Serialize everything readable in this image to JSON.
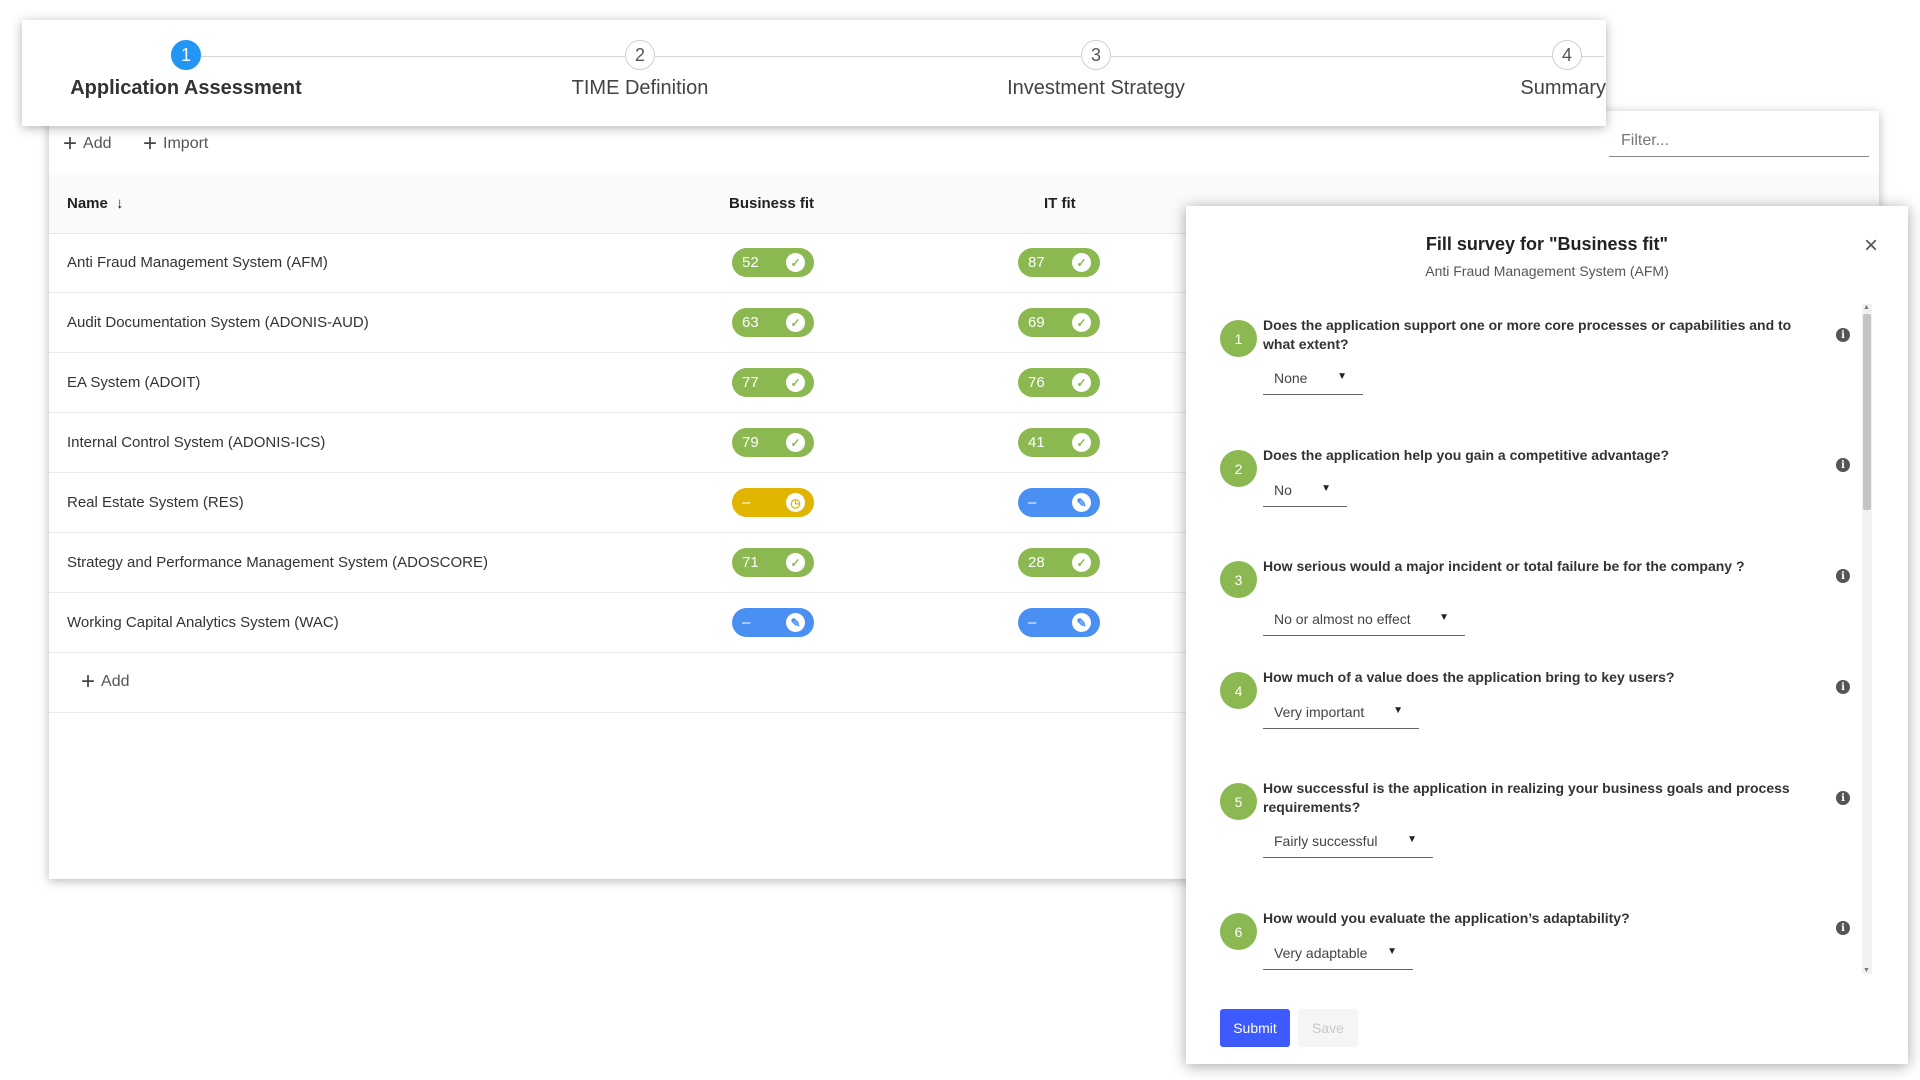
{
  "stepper": {
    "steps": [
      {
        "number": "1",
        "label": "Application Assessment"
      },
      {
        "number": "2",
        "label": "TIME Definition"
      },
      {
        "number": "3",
        "label": "Investment Strategy"
      },
      {
        "number": "4",
        "label": "Summary"
      }
    ],
    "active_step": 1
  },
  "toolbar": {
    "add_label": "Add",
    "import_label": "Import",
    "filter_placeholder": "Filter..."
  },
  "table": {
    "columns": {
      "name": "Name",
      "sort_indicator": "↓",
      "business_fit": "Business fit",
      "it_fit": "IT fit"
    },
    "rows": [
      {
        "name": "Anti Fraud Management System (AFM)",
        "business_fit": "52",
        "business_status": "done",
        "it_fit": "87",
        "it_status": "done"
      },
      {
        "name": "Audit Documentation System (ADONIS-AUD)",
        "business_fit": "63",
        "business_status": "done",
        "it_fit": "69",
        "it_status": "done"
      },
      {
        "name": "EA System (ADOIT)",
        "business_fit": "77",
        "business_status": "done",
        "it_fit": "76",
        "it_status": "done"
      },
      {
        "name": "Internal Control System (ADONIS-ICS)",
        "business_fit": "79",
        "business_status": "done",
        "it_fit": "41",
        "it_status": "done"
      },
      {
        "name": "Real Estate System (RES)",
        "business_fit": "–",
        "business_status": "pending",
        "it_fit": "–",
        "it_status": "edit"
      },
      {
        "name": "Strategy and Performance Management System (ADOSCORE)",
        "business_fit": "71",
        "business_status": "done",
        "it_fit": "28",
        "it_status": "done"
      },
      {
        "name": "Working Capital Analytics System (WAC)",
        "business_fit": "–",
        "business_status": "edit",
        "it_fit": "–",
        "it_status": "edit"
      }
    ],
    "add_row_label": "Add",
    "colors": {
      "done": "#8bb850",
      "pending": "#e0b400",
      "edit": "#4a8ff2"
    }
  },
  "dialog": {
    "title": "Fill survey for \"Business fit\"",
    "subtitle": "Anti Fraud Management System (AFM)",
    "close_symbol": "×",
    "questions": [
      {
        "number": "1",
        "text": "Does the application support one or more core processes or capabilities and to what extent?",
        "answer": "None"
      },
      {
        "number": "2",
        "text": "Does the application help you gain a competitive advantage?",
        "answer": "No"
      },
      {
        "number": "3",
        "text": "How serious would a major incident or total failure be for the company ?",
        "answer": "No or almost no effect"
      },
      {
        "number": "4",
        "text": "How much of a value does the application bring to key users?",
        "answer": "Very important"
      },
      {
        "number": "5",
        "text": "How successful is the application in realizing your business goals and process requirements?",
        "answer": "Fairly successful"
      },
      {
        "number": "6",
        "text": "How would you evaluate the application’s adaptability?",
        "answer": "Very adaptable"
      }
    ],
    "submit_label": "Submit",
    "save_label": "Save",
    "accent_color": "#3d5afe"
  }
}
